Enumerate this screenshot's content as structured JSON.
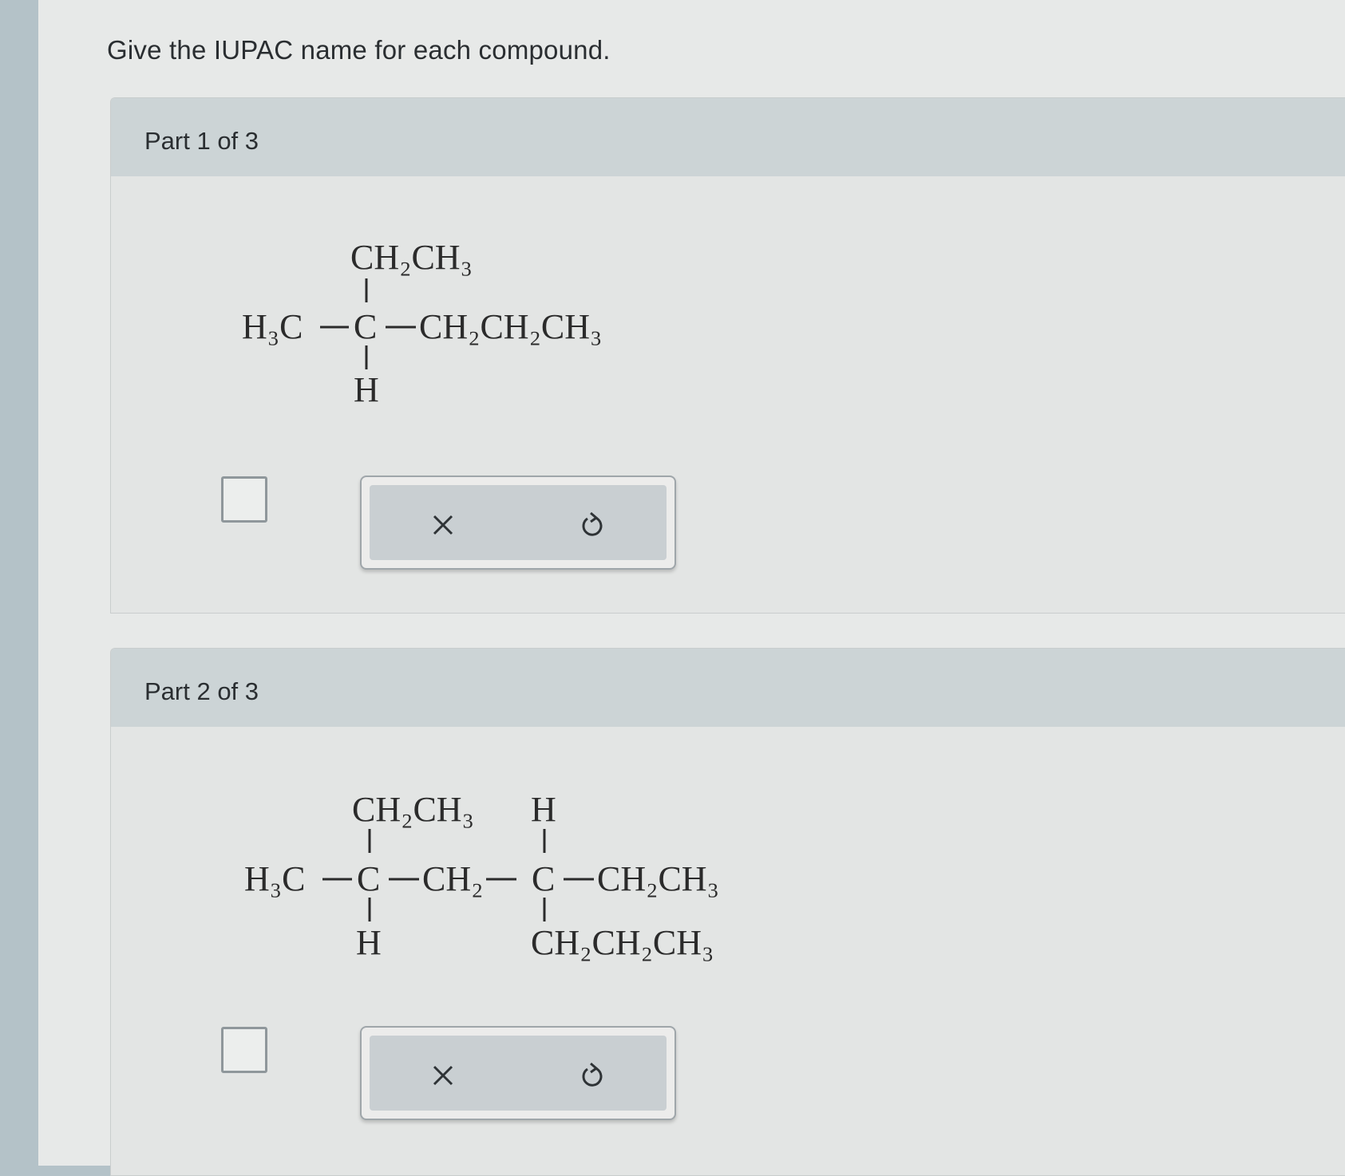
{
  "question": "Give the IUPAC name for each compound.",
  "parts": [
    {
      "title": "Part 1 of 3",
      "formula_top": "CH₂CH₃",
      "formula_left": "H₃C",
      "formula_center": "C",
      "formula_right": "CH₂CH₂CH₃",
      "formula_bottom": "H",
      "clear_icon": "x-icon",
      "undo_icon": "undo-icon"
    },
    {
      "title": "Part 2 of 3",
      "formula_top_left": "CH₂CH₃",
      "formula_top_right": "H",
      "formula_left": "H₃C",
      "formula_center_1": "C",
      "formula_middle": "CH₂",
      "formula_center_2": "C",
      "formula_right": "CH₂CH₃",
      "formula_bottom_left": "H",
      "formula_bottom_right": "CH₂CH₂CH₃",
      "clear_icon": "x-icon",
      "undo_icon": "undo-icon"
    }
  ],
  "colors": {
    "header": "#ccd4d6",
    "panel": "#e3e5e4",
    "toolbar": "#c9cfd2",
    "text": "#2a2e31"
  }
}
